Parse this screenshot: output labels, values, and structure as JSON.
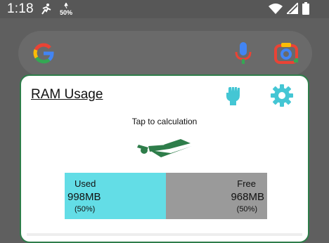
{
  "status_bar": {
    "time": "1:18",
    "battery_saver_text": "50%",
    "icons": [
      "running-icon",
      "battery-saver-icon",
      "wifi-icon",
      "signal-icon",
      "battery-icon"
    ]
  },
  "search_widget": {
    "icons": [
      "google-logo",
      "mic-icon",
      "lens-icon"
    ]
  },
  "ram_widget": {
    "title": "RAM Usage",
    "tap_label": "Tap to calculation",
    "used": {
      "label": "Used",
      "value": "998MB",
      "percent_text": "(50%)",
      "fraction": 0.5
    },
    "free": {
      "label": "Free",
      "value": "968MB",
      "percent_text": "(50%)"
    },
    "colors": {
      "used": "#63dde6",
      "free": "#9a9a9a",
      "accent": "#2e7d4a",
      "icon": "#44c6d4"
    }
  }
}
